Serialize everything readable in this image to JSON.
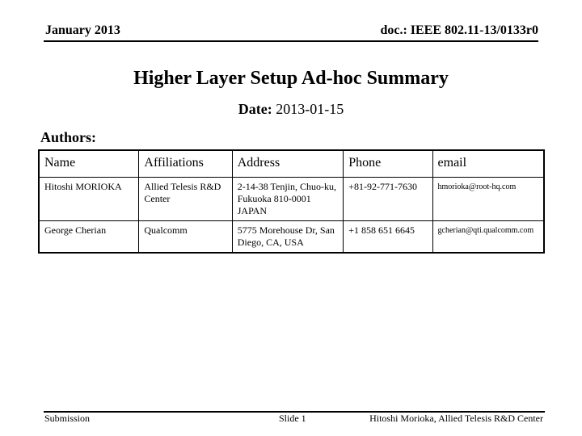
{
  "header": {
    "date": "January 2013",
    "doc_id": "doc.: IEEE 802.11-13/0133r0"
  },
  "title": "Higher Layer Setup Ad-hoc Summary",
  "date_line": {
    "label": "Date:",
    "value": "2013-01-15"
  },
  "authors_label": "Authors:",
  "authors_table": {
    "columns": [
      "Name",
      "Affiliations",
      "Address",
      "Phone",
      "email"
    ],
    "rows": [
      {
        "name": "Hitoshi MORIOKA",
        "affiliation": "Allied Telesis R&D Center",
        "address_lines": [
          "2-14-38 Tenjin, Chuo-ku,",
          "Fukuoka 810-0001",
          "JAPAN"
        ],
        "phone": "+81-92-771-7630",
        "email": "hmorioka@root-hq.com"
      },
      {
        "name": "George Cherian",
        "affiliation": "Qualcomm",
        "address_lines": [
          "5775 Morehouse Dr, San",
          "Diego, CA, USA"
        ],
        "phone": "+1 858 651 6645",
        "email": "gcherian@qti.qualcomm.com"
      }
    ]
  },
  "footer": {
    "left": "Submission",
    "center": "Slide 1",
    "right": "Hitoshi Morioka, Allied Telesis R&D Center"
  }
}
